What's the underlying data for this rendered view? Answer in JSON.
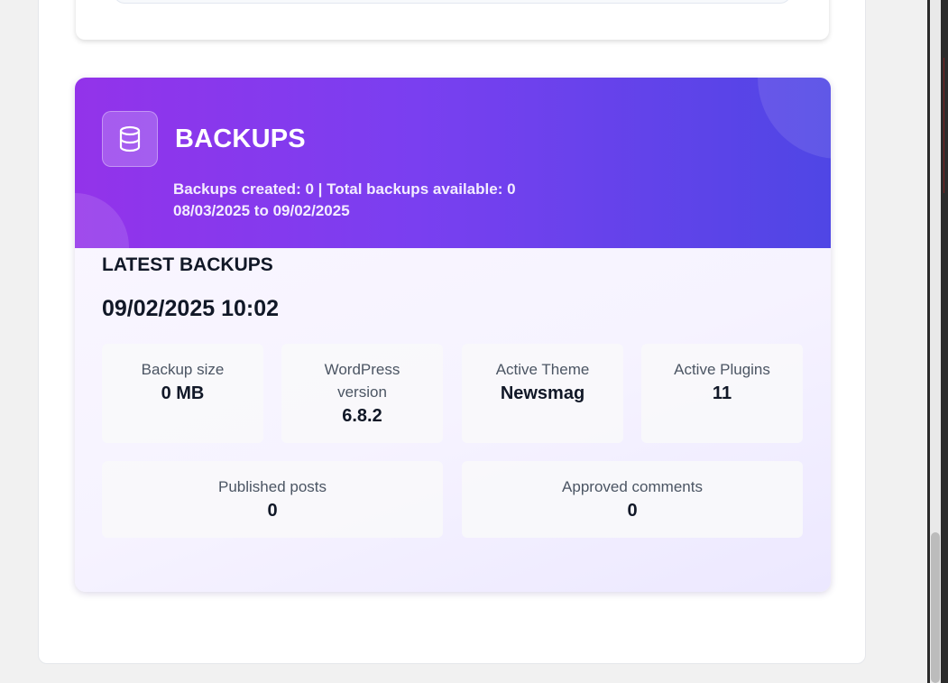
{
  "backups": {
    "title": "BACKUPS",
    "icon": "database-icon",
    "stats_line": "Backups created: 0 | Total backups available: 0",
    "date_range": "08/03/2025 to 09/02/2025",
    "gradient": [
      "#9333ea",
      "#4f46e5"
    ]
  },
  "latest": {
    "heading": "LATEST BACKUPS",
    "datetime": "09/02/2025 10:02",
    "stats": [
      {
        "label": "Backup size",
        "value": "0 MB"
      },
      {
        "label": "WordPress version",
        "value": "6.8.2"
      },
      {
        "label": "Active Theme",
        "value": "Newsmag"
      },
      {
        "label": "Active Plugins",
        "value": "11"
      },
      {
        "label": "Published posts",
        "value": "0"
      },
      {
        "label": "Approved comments",
        "value": "0"
      }
    ]
  }
}
